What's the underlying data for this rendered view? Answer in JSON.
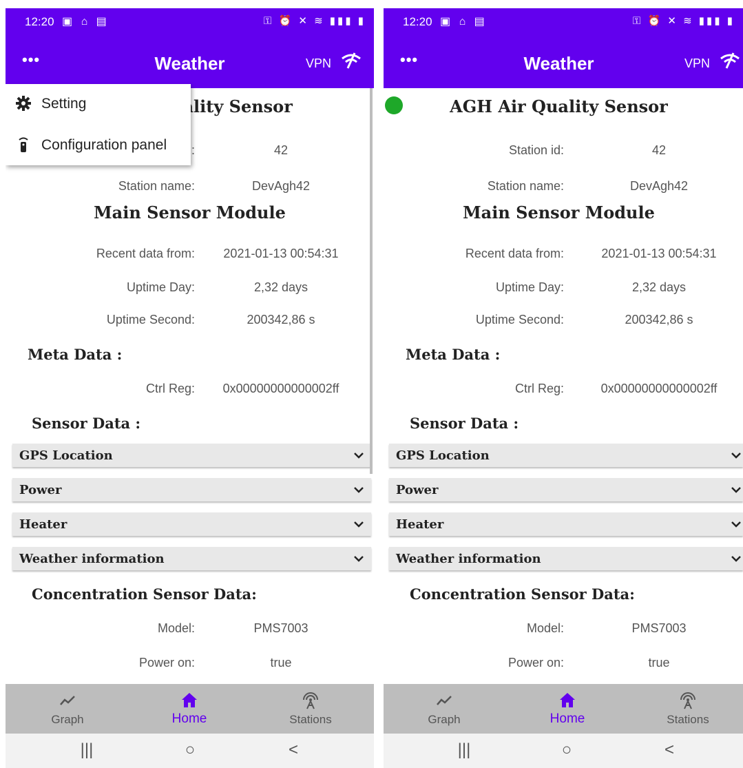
{
  "status_bar": {
    "time": "12:20"
  },
  "app_bar": {
    "menu": "•••",
    "title": "Weather",
    "vpn": "VPN"
  },
  "popup_menu": {
    "items": [
      {
        "label": "Setting",
        "icon": "gear-icon"
      },
      {
        "label": "Configuration panel",
        "icon": "remote-control-icon"
      }
    ]
  },
  "station": {
    "title": "AGH Air Quality Sensor",
    "title_partial": "uality Sensor",
    "status_color": "#1ea829",
    "id_label": "Station id:",
    "id_value": "42",
    "name_label": "Station name:",
    "name_value": "DevAgh42"
  },
  "main_module": {
    "title": "Main Sensor Module",
    "recent_label": "Recent data from:",
    "recent_value": "2021-01-13 00:54:31",
    "uptime_day_label": "Uptime Day:",
    "uptime_day_value": "2,32 days",
    "uptime_second_label": "Uptime Second:",
    "uptime_second_value": "200342,86 s"
  },
  "meta": {
    "title": "Meta Data :",
    "ctrl_label": "Ctrl Reg:",
    "ctrl_value": "0x00000000000002ff"
  },
  "sensor_data": {
    "title": "Sensor Data :",
    "sections": [
      "GPS Location",
      "Power",
      "Heater",
      "Weather information"
    ]
  },
  "concentration": {
    "title": "Concentration Sensor Data:",
    "model_label": "Model:",
    "model_value": "PMS7003",
    "power_label": "Power on:",
    "power_value": "true"
  },
  "bottom_nav": {
    "items": [
      {
        "label": "Graph",
        "icon": "graph-icon"
      },
      {
        "label": "Home",
        "icon": "home-icon"
      },
      {
        "label": "Stations",
        "icon": "antenna-icon"
      }
    ]
  },
  "system_nav": {
    "recents": "|||",
    "home": "○",
    "back": "<"
  },
  "colors": {
    "primary": "#6200ee",
    "nav_bg": "#bdbdbd",
    "expander_bg": "#e8e8e8"
  }
}
